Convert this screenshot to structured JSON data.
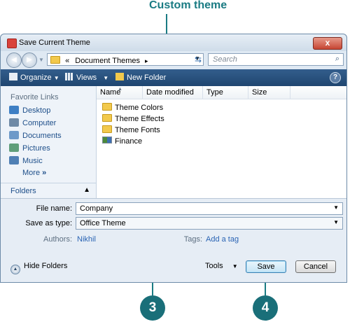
{
  "callouts": {
    "title": "Custom theme",
    "step3": "3",
    "step4": "4"
  },
  "window": {
    "title": "Save Current Theme",
    "close": "x"
  },
  "address": {
    "prefix": "«",
    "path": "Document Themes",
    "sep": "▸",
    "search_placeholder": "Search"
  },
  "toolbar": {
    "organize": "Organize",
    "views": "Views",
    "new_folder": "New Folder",
    "help": "?"
  },
  "nav": {
    "header": "Favorite Links",
    "items": [
      {
        "label": "Desktop",
        "icon": "desktop-icon",
        "color": "#3e7fc4"
      },
      {
        "label": "Computer",
        "icon": "computer-icon",
        "color": "#6f8aa6"
      },
      {
        "label": "Documents",
        "icon": "documents-icon",
        "color": "#6d99c9"
      },
      {
        "label": "Pictures",
        "icon": "pictures-icon",
        "color": "#5f9e7a"
      },
      {
        "label": "Music",
        "icon": "music-icon",
        "color": "#4f7fb4"
      }
    ],
    "more": "More",
    "more_arrow": "»",
    "folders": "Folders"
  },
  "files": {
    "columns": [
      "Name",
      "Date modified",
      "Type",
      "Size"
    ],
    "rows": [
      {
        "name": "Theme Colors",
        "kind": "folder"
      },
      {
        "name": "Theme Effects",
        "kind": "folder"
      },
      {
        "name": "Theme Fonts",
        "kind": "folder"
      },
      {
        "name": "Finance",
        "kind": "theme"
      }
    ]
  },
  "form": {
    "file_name_label": "File name:",
    "file_name_value": "Company",
    "save_type_label": "Save as type:",
    "save_type_value": "Office Theme",
    "authors_label": "Authors:",
    "authors_value": "Nikhil",
    "tags_label": "Tags:",
    "tags_value": "Add a tag"
  },
  "footer": {
    "hide_folders": "Hide Folders",
    "tools": "Tools",
    "save": "Save",
    "cancel": "Cancel"
  },
  "colors": {
    "accent": "#1a7b83",
    "toolbar": "#2a5480"
  }
}
